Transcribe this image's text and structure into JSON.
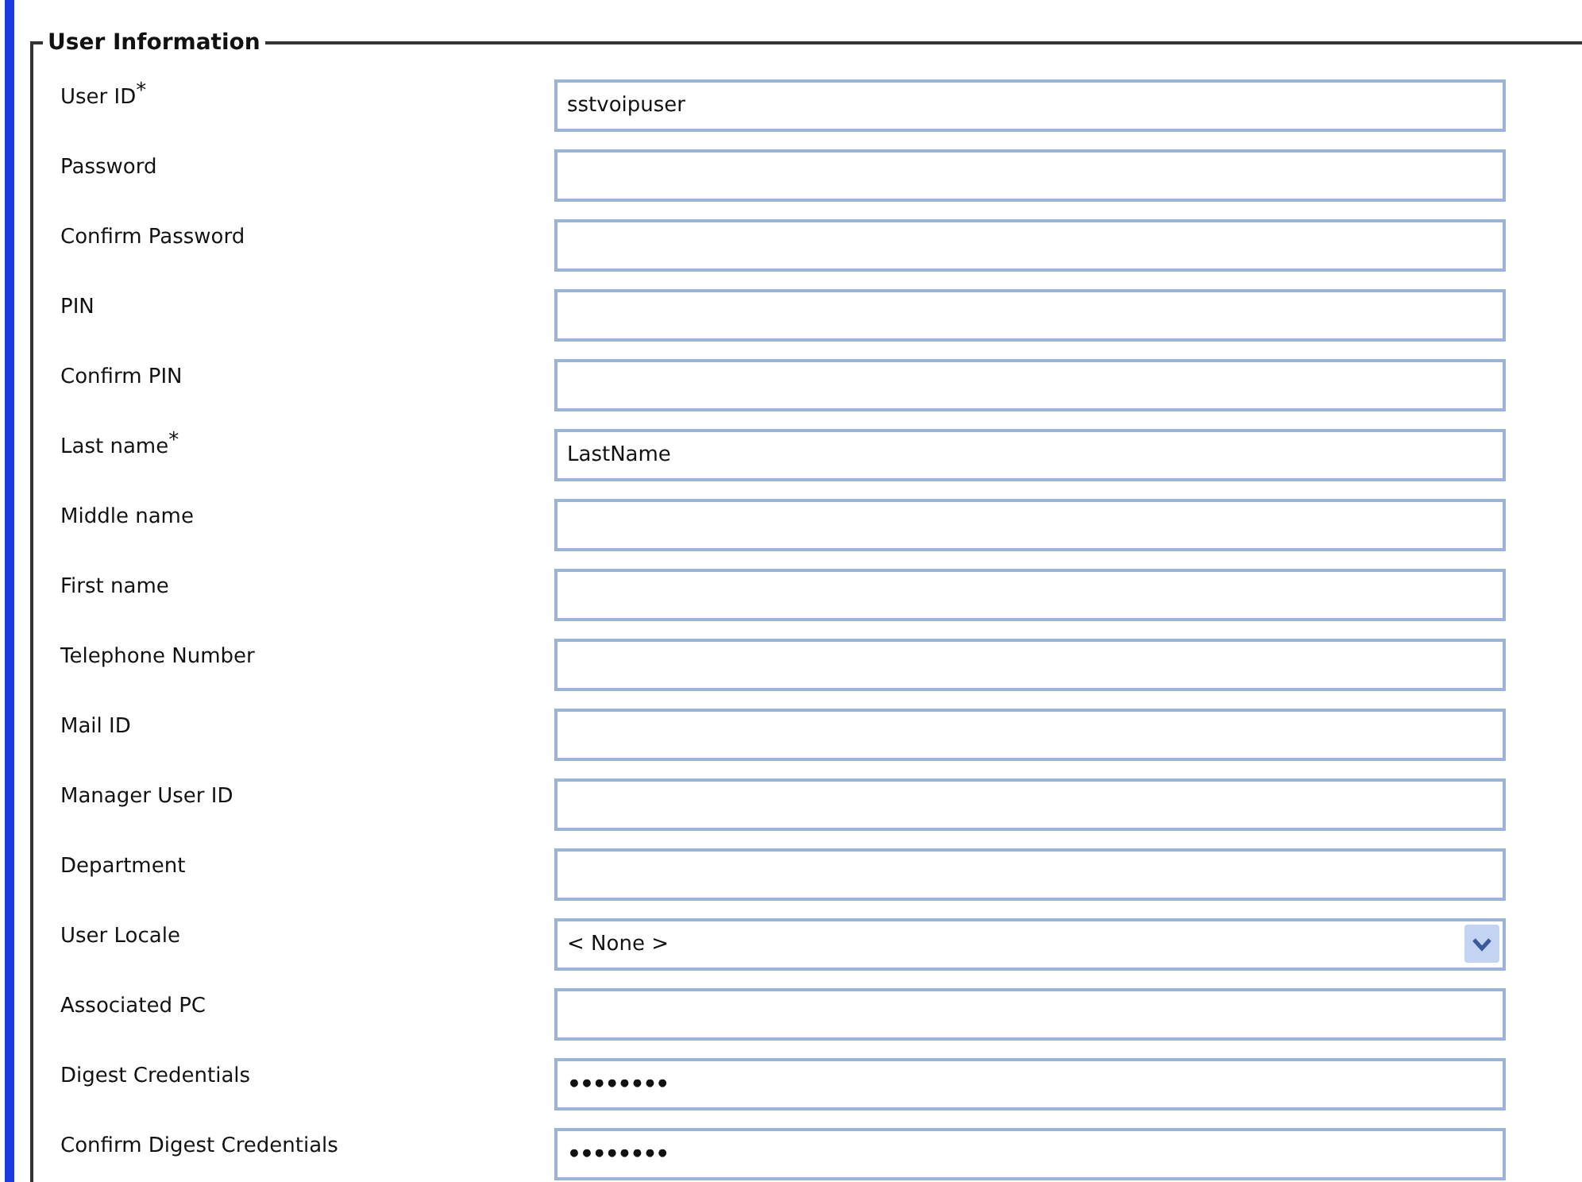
{
  "section": {
    "title": "User Information"
  },
  "fields": [
    {
      "label": "User ID$^{*}$",
      "kind": "text",
      "value": "sstvoipuser"
    },
    {
      "label": "Password",
      "kind": "text"
    },
    {
      "label": "Confirm Password",
      "kind": "text"
    },
    {
      "label": "PIN",
      "kind": "text"
    },
    {
      "label": "Confirm PIN",
      "kind": "text"
    },
    {
      "label": "Last name$^{*}$",
      "kind": "text",
      "value": "LastName"
    },
    {
      "label": "Middle name",
      "kind": "text"
    },
    {
      "label": "First name",
      "kind": "text"
    },
    {
      "label": "Telephone Number",
      "kind": "text"
    },
    {
      "label": "Mail ID",
      "kind": "text"
    },
    {
      "label": "Manager User ID",
      "kind": "text"
    },
    {
      "label": "Department",
      "kind": "text"
    },
    {
      "label": "User Locale",
      "kind": "select",
      "value": "< None >"
    },
    {
      "label": "Associated PC",
      "kind": "text"
    },
    {
      "label": "Digest Credentials",
      "kind": "masked",
      "value": "••••••••"
    },
    {
      "label": "Confirm Digest Credentials",
      "kind": "masked",
      "value": "••••••••"
    }
  ]
}
